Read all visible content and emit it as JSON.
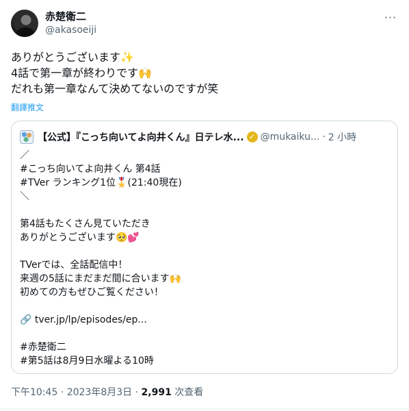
{
  "author": {
    "name": "赤楚衛二",
    "handle": "@akasoeiji"
  },
  "more_label": "···",
  "tweet_lines": [
    "ありがとうございます✨",
    "4話で第一章が終わりです🙌",
    "だれも第一章なんて決めてないのですが笑"
  ],
  "translate_label": "翻譯推文",
  "quote": {
    "name": "【公式】『こっち向いてよ向井くん』日テレ水...",
    "verified_icon": "check-badge-icon",
    "handle": "@mukaiku...",
    "separator": "·",
    "time": "2 小時",
    "lines": [
      "／",
      "#こっち向いてよ向井くん 第4話",
      "#TVer ランキング1位🎖️(21:40現在)",
      "＼",
      "",
      "第4話もたくさん見ていただき",
      "ありがとうございます🥺💕",
      "",
      "TVerでは、全話配信中！",
      "来週の5話にまだまだ間に合います🙌",
      "初めての方もぜひご覧ください！",
      "",
      "🔗 tver.jp/lp/episodes/ep...",
      "",
      "#赤楚衛二",
      "#第5話は8月9日水曜よる10時"
    ]
  },
  "footer": {
    "time": "下午10:45",
    "sep1": " · ",
    "date": "2023年8月3日",
    "sep2": " · ",
    "views_count": "2,991",
    "views_label": " 次查看"
  },
  "colors": {
    "accent": "#1d9bf0",
    "secondary_text": "#536471",
    "border": "#cfd9de",
    "verified_gold": "#e2b719"
  }
}
